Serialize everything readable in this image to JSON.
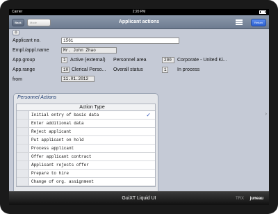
{
  "statusbar": {
    "carrier": "Carrier",
    "time": "2:20 PM"
  },
  "navbar": {
    "back_label": "Back",
    "mode_placeholder": "Mode",
    "title": "Applicant actions",
    "return_label": "Return"
  },
  "toolbar": {
    "icon": "settings-icon"
  },
  "form": {
    "applicant_no_label": "Applicant no.",
    "applicant_no_value": "1561",
    "name_label": "Empl./appl.name",
    "name_value": "Mr. John Zhao",
    "group_label": "App.group",
    "group_code": "1",
    "group_text": "Active (external)",
    "personnel_area_label": "Personnel area",
    "personnel_area_code": "200",
    "personnel_area_text": "Corporate - United Ki...",
    "range_label": "App.range",
    "range_code": "10",
    "range_text": "Clerical Perso...",
    "overall_status_label": "Overall status",
    "overall_status_code": "1",
    "overall_status_text": "In process",
    "from_label": "from",
    "from_value": "11.01.2013"
  },
  "actions_panel": {
    "title": "Personnel Actions",
    "column_header": "Action Type",
    "rows": [
      {
        "label": "Initial entry of basic data",
        "checked": true
      },
      {
        "label": "Enter additional data",
        "checked": false
      },
      {
        "label": "Reject applicant",
        "checked": false
      },
      {
        "label": "Put applicant on hold",
        "checked": false
      },
      {
        "label": "Process applicant",
        "checked": false
      },
      {
        "label": "Offer applicant contract",
        "checked": false
      },
      {
        "label": "Applicant rejects offer",
        "checked": false
      },
      {
        "label": "Prepare to hire",
        "checked": false
      },
      {
        "label": "Change of org. assignment",
        "checked": false
      }
    ],
    "check_glyph": "✓"
  },
  "bottombar": {
    "brand": "GuiXT Liquid UI",
    "trx": "TRX",
    "user": "juneau"
  }
}
